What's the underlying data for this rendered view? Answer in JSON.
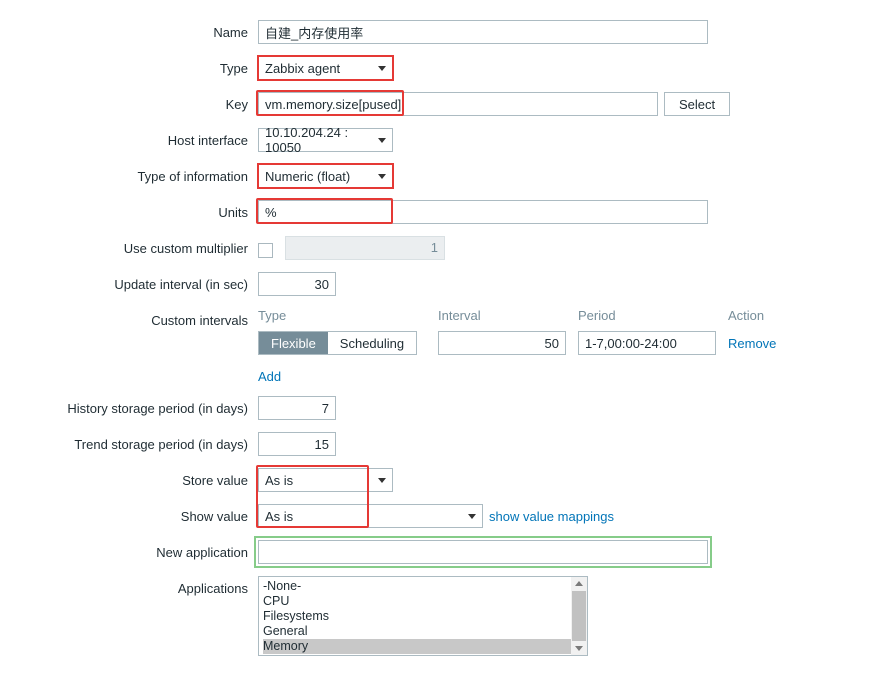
{
  "labels": {
    "name": "Name",
    "type": "Type",
    "key": "Key",
    "host_interface": "Host interface",
    "type_of_info": "Type of information",
    "units": "Units",
    "use_custom_mult": "Use custom multiplier",
    "update_interval": "Update interval (in sec)",
    "custom_intervals": "Custom intervals",
    "history_period": "History storage period (in days)",
    "trend_period": "Trend storage period (in days)",
    "store_value": "Store value",
    "show_value": "Show value",
    "new_application": "New application",
    "applications": "Applications"
  },
  "values": {
    "name": "自建_内存使用率",
    "type": "Zabbix agent",
    "key": "vm.memory.size[pused]",
    "host_interface": "10.10.204.24 : 10050",
    "type_of_info": "Numeric (float)",
    "units": "%",
    "custom_mult_value": "1",
    "update_interval": "30",
    "history_period": "7",
    "trend_period": "15",
    "store_value": "As is",
    "show_value": "As is",
    "new_application": ""
  },
  "buttons": {
    "select": "Select",
    "add": "Add",
    "remove": "Remove",
    "show_value_mappings": "show value mappings"
  },
  "ci": {
    "head_type": "Type",
    "head_interval": "Interval",
    "head_period": "Period",
    "head_action": "Action",
    "seg_flexible": "Flexible",
    "seg_scheduling": "Scheduling",
    "row_interval": "50",
    "row_period": "1-7,00:00-24:00"
  },
  "applications": {
    "opts": [
      "-None-",
      "CPU",
      "Filesystems",
      "General",
      "Memory"
    ],
    "selected": "Memory"
  }
}
